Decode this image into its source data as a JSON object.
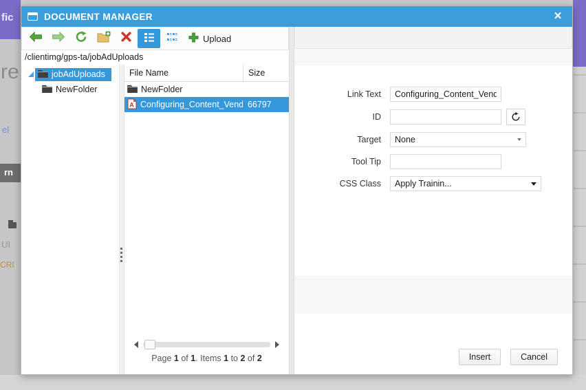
{
  "dialog": {
    "title": "DOCUMENT MANAGER",
    "close_glyph": "×"
  },
  "toolbar": {
    "upload_label": "Upload"
  },
  "breadcrumb": "/clientimg/gps-ta/jobAdUploads",
  "tree": {
    "items": [
      {
        "label": "jobAdUploads",
        "selected": true
      },
      {
        "label": "NewFolder",
        "selected": false
      }
    ]
  },
  "file_list": {
    "columns": {
      "name": "File Name",
      "size": "Size"
    },
    "rows": [
      {
        "name": "NewFolder",
        "type": "folder",
        "size": "",
        "selected": false
      },
      {
        "name": "Configuring_Content_Vendo",
        "type": "pdf",
        "size": "66797",
        "selected": true
      }
    ],
    "pagination_parts": [
      "Page ",
      "1",
      " of ",
      "1",
      ". Items ",
      "1",
      " to ",
      "2",
      " of ",
      "2"
    ]
  },
  "form": {
    "link_text": {
      "label": "Link Text",
      "value": "Configuring_Content_Vendor"
    },
    "id": {
      "label": "ID",
      "value": ""
    },
    "target": {
      "label": "Target",
      "value": "None"
    },
    "tool_tip": {
      "label": "Tool Tip",
      "value": ""
    },
    "css_class": {
      "label": "CSS Class",
      "value": "Apply Trainin..."
    }
  },
  "footer": {
    "insert_label": "Insert",
    "cancel_label": "Cancel"
  },
  "background": {
    "fragments": {
      "top_left": "fic",
      "heading": "re",
      "link": "el",
      "button": "rn",
      "label1": "UI",
      "label2": "CRI"
    }
  },
  "colors": {
    "titlebar_blue": "#3b9edb",
    "selection_blue": "#3598db",
    "backdrop_purple": "#7b6cc8",
    "upload_green": "#3f9e3f",
    "delete_red": "#c5392c"
  }
}
